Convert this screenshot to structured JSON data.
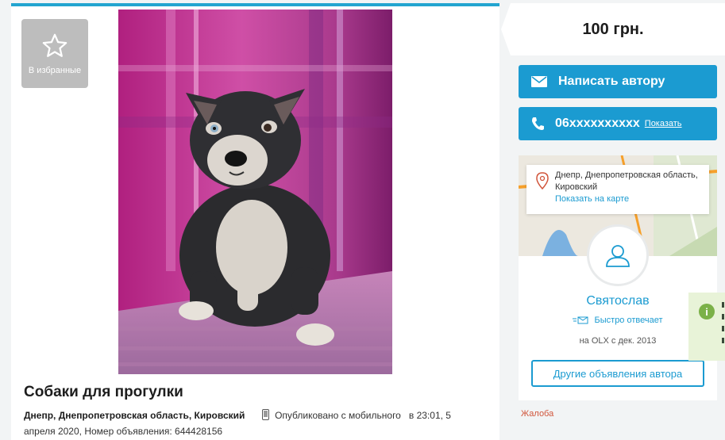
{
  "favorite": {
    "label": "В избранные",
    "icon": "star-outline-icon"
  },
  "listing": {
    "title": "Собаки для прогулки",
    "location": "Днепр, Днепропетровская область, Кировский",
    "published_via": "Опубликовано с мобильного",
    "published_at": "в 23:01, 5 апреля 2020,",
    "ad_number": "Номер объявления: 644428156"
  },
  "price": "100 грн.",
  "actions": {
    "write_label": "Написать автору",
    "phone_number": "06xxxxxxxxxx",
    "phone_show_label": "Показать"
  },
  "map_popup": {
    "address": "Днепр, Днепропетровская область, Кировский",
    "show_on_map": "Показать на карте"
  },
  "seller": {
    "name": "Святослав",
    "fast_reply": "Быстро отвечает",
    "since": "на OLX с дек. 2013",
    "other_ads_label": "Другие объявления автора"
  },
  "complaint_label": "Жалоба",
  "info_tip": {
    "icon_glyph": "i"
  },
  "colors": {
    "accent": "#1b9bd1",
    "top_border": "#23a5d0",
    "complaint": "#d1553b",
    "background": "#f2f4f5"
  }
}
